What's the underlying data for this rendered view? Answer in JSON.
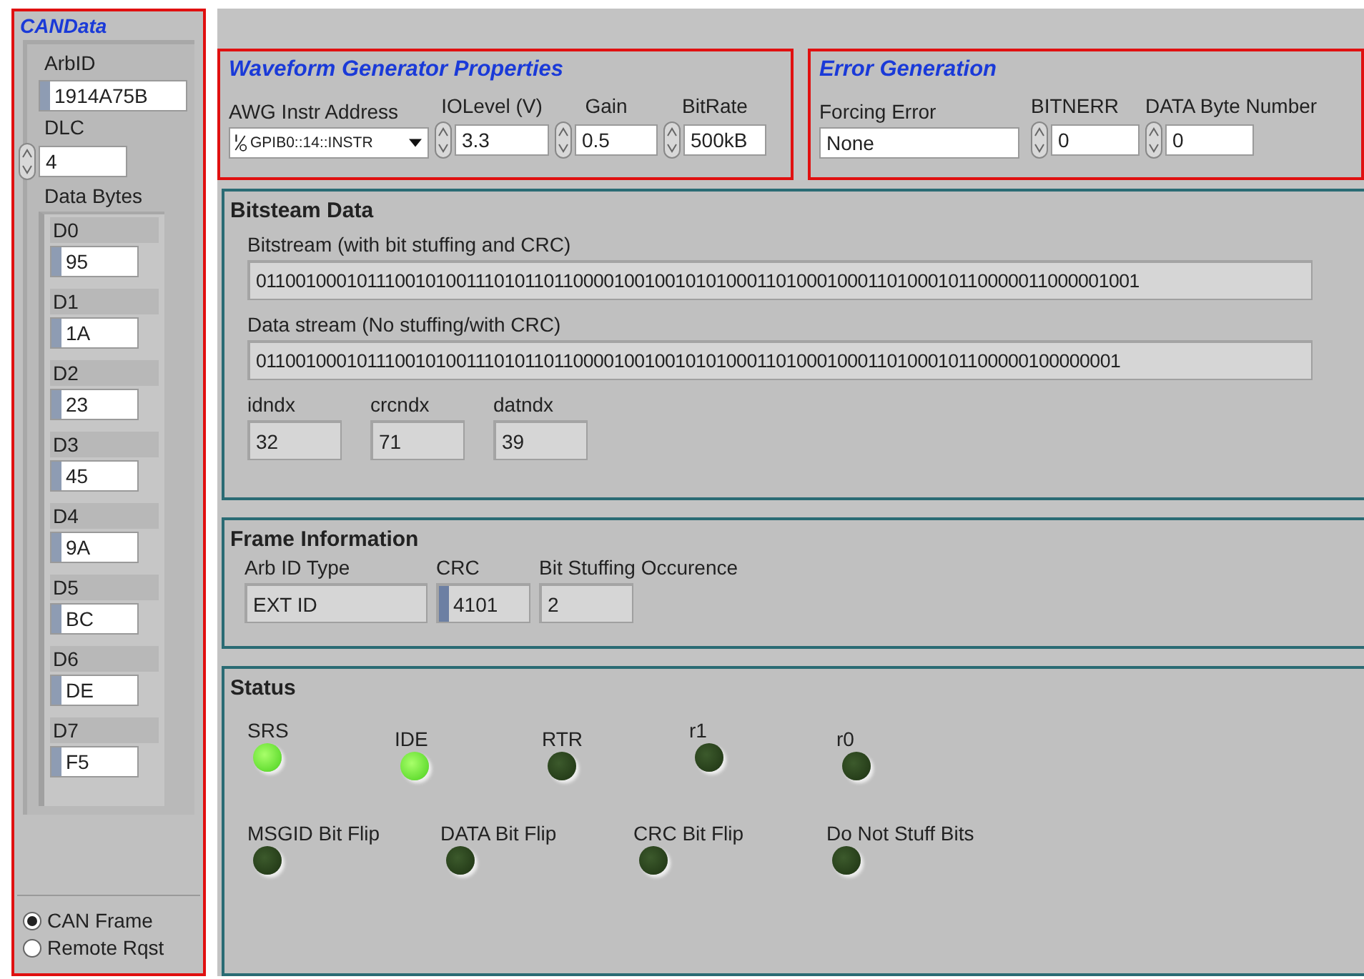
{
  "can_data": {
    "title": "CANData",
    "arb_id": {
      "label": "ArbID",
      "value": "1914A75B"
    },
    "dlc": {
      "label": "DLC",
      "value": "4"
    },
    "data_bytes": {
      "label": "Data Bytes",
      "items": [
        {
          "label": "D0",
          "value": "95"
        },
        {
          "label": "D1",
          "value": "1A"
        },
        {
          "label": "D2",
          "value": "23"
        },
        {
          "label": "D3",
          "value": "45"
        },
        {
          "label": "D4",
          "value": "9A"
        },
        {
          "label": "D5",
          "value": "BC"
        },
        {
          "label": "D6",
          "value": "DE"
        },
        {
          "label": "D7",
          "value": "F5"
        }
      ]
    },
    "frame_type": [
      {
        "label": "CAN Frame",
        "selected": true
      },
      {
        "label": "Remote Rqst",
        "selected": false
      }
    ]
  },
  "waveform_generator": {
    "title": "Waveform Generator Properties",
    "awg_address": {
      "label": "AWG Instr Address",
      "value": "GPIB0::14::INSTR"
    },
    "io_level": {
      "label": "IOLevel (V)",
      "value": "3.3"
    },
    "gain": {
      "label": "Gain",
      "value": "0.5"
    },
    "bit_rate": {
      "label": "BitRate",
      "value": "500kB"
    }
  },
  "error_generation": {
    "title": "Error Generation",
    "forcing_error": {
      "label": "Forcing Error",
      "value": "None"
    },
    "bitnerr": {
      "label": "BITNERR",
      "value": "0"
    },
    "data_byte_number": {
      "label": "DATA Byte Number",
      "value": "0"
    }
  },
  "bitstream_data": {
    "title": "Bitsteam Data",
    "bitstream": {
      "label": "Bitstream (with bit stuffing and CRC)",
      "value": "0110010001011100101001110101101100001001001010100011010001000110100010110000011000001001"
    },
    "data_stream": {
      "label": "Data stream (No stuffing/with CRC)",
      "value": "01100100010111001010011101011011000010010010101000110100010001101000101100000100000001"
    },
    "indices": [
      {
        "label": "idndx",
        "value": "32"
      },
      {
        "label": "crcndx",
        "value": "71"
      },
      {
        "label": "datndx",
        "value": "39"
      }
    ]
  },
  "frame_information": {
    "title": "Frame Information",
    "arb_id_type": {
      "label": "Arb ID Type",
      "value": "EXT ID"
    },
    "crc": {
      "label": "CRC",
      "value": "4101"
    },
    "bit_stuffing": {
      "label": "Bit Stuffing Occurence",
      "value": "2"
    }
  },
  "status": {
    "title": "Status",
    "row_1": [
      {
        "label": "SRS",
        "on": true
      },
      {
        "label": "IDE",
        "on": true
      },
      {
        "label": "RTR",
        "on": false
      },
      {
        "label": "r1",
        "on": false
      },
      {
        "label": "r0",
        "on": false
      }
    ],
    "row_2": [
      {
        "label": "MSGID Bit Flip",
        "on": false
      },
      {
        "label": "DATA Bit Flip",
        "on": false
      },
      {
        "label": "CRC Bit Flip",
        "on": false
      },
      {
        "label": "Do Not Stuff Bits",
        "on": false
      }
    ]
  }
}
